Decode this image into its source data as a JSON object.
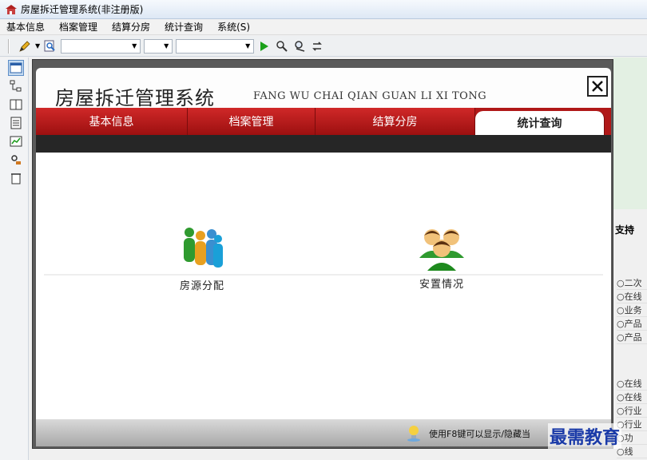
{
  "titlebar": {
    "title": "房屋拆迁管理系统(非注册版)"
  },
  "menu": [
    "基本信息",
    "档案管理",
    "结算分房",
    "统计查询",
    "系统(S)"
  ],
  "window": {
    "title_cn": "房屋拆迁管理系统",
    "title_en": "FANG WU CHAI QIAN GUAN LI XI TONG",
    "close_icon": "close-icon",
    "tabs": [
      {
        "label": "基本信息",
        "active": false
      },
      {
        "label": "档案管理",
        "active": false
      },
      {
        "label": "结算分房",
        "active": false
      },
      {
        "label": "统计查询",
        "active": true
      }
    ],
    "items": [
      {
        "label": "房源分配",
        "icon": "people-group-icon"
      },
      {
        "label": "安置情况",
        "icon": "users-icon"
      }
    ],
    "hint": "使用F8键可以显示/隐藏当"
  },
  "background": {
    "support": "支持",
    "list_a": [
      "○二次",
      "○在线",
      "○业务",
      "○产品",
      "○产品"
    ],
    "list_b": [
      "○在线",
      "○在线",
      "○行业",
      "○行业",
      "○功",
      "○线"
    ]
  },
  "watermark": "最需教育",
  "colors": {
    "tab_red": "#b01818",
    "accent_blue": "#5b8cc6"
  }
}
